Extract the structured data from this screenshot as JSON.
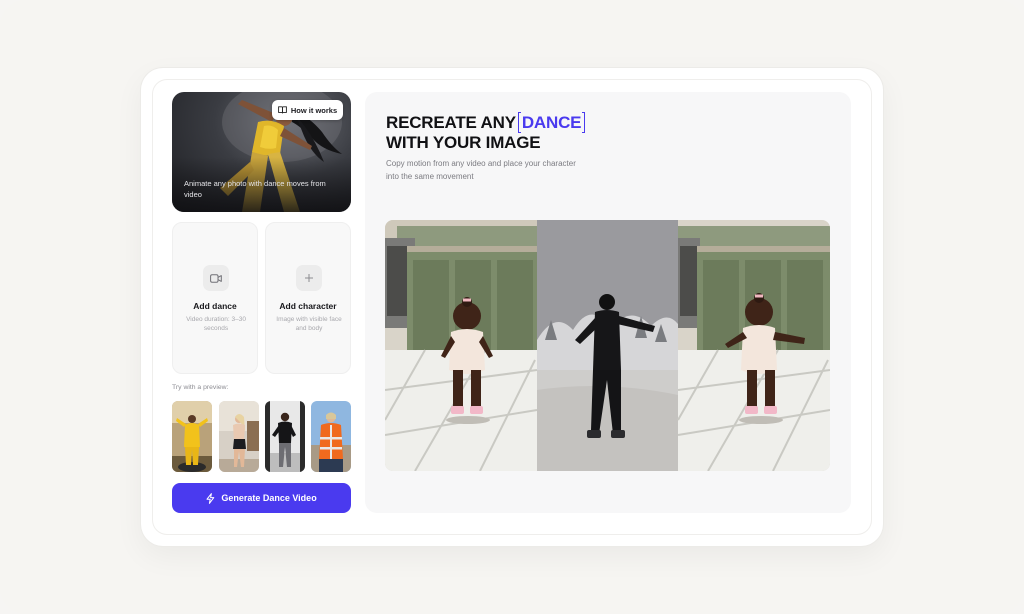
{
  "hero": {
    "how_it_works_label": "How it works",
    "caption": "Animate any photo with dance moves from video"
  },
  "upload": {
    "dance": {
      "title": "Add dance",
      "subtitle": "Video duration: 3–30 seconds"
    },
    "character": {
      "title": "Add character",
      "subtitle": "Image with visible face and body"
    }
  },
  "presets": {
    "label": "Try with a preview:"
  },
  "generate_label": "Generate Dance Video",
  "panel": {
    "headline_part1": "RECREATE ANY",
    "headline_accent": "DANCE",
    "headline_part2": "WITH YOUR IMAGE",
    "description": "Copy motion from any video and place your character into the same movement"
  },
  "colors": {
    "accent": "#4a3aef",
    "background": "#f6f5f3"
  },
  "icons": {
    "book": "book-icon",
    "video": "video-camera-icon",
    "plus": "plus-icon",
    "bolt": "lightning-icon"
  }
}
